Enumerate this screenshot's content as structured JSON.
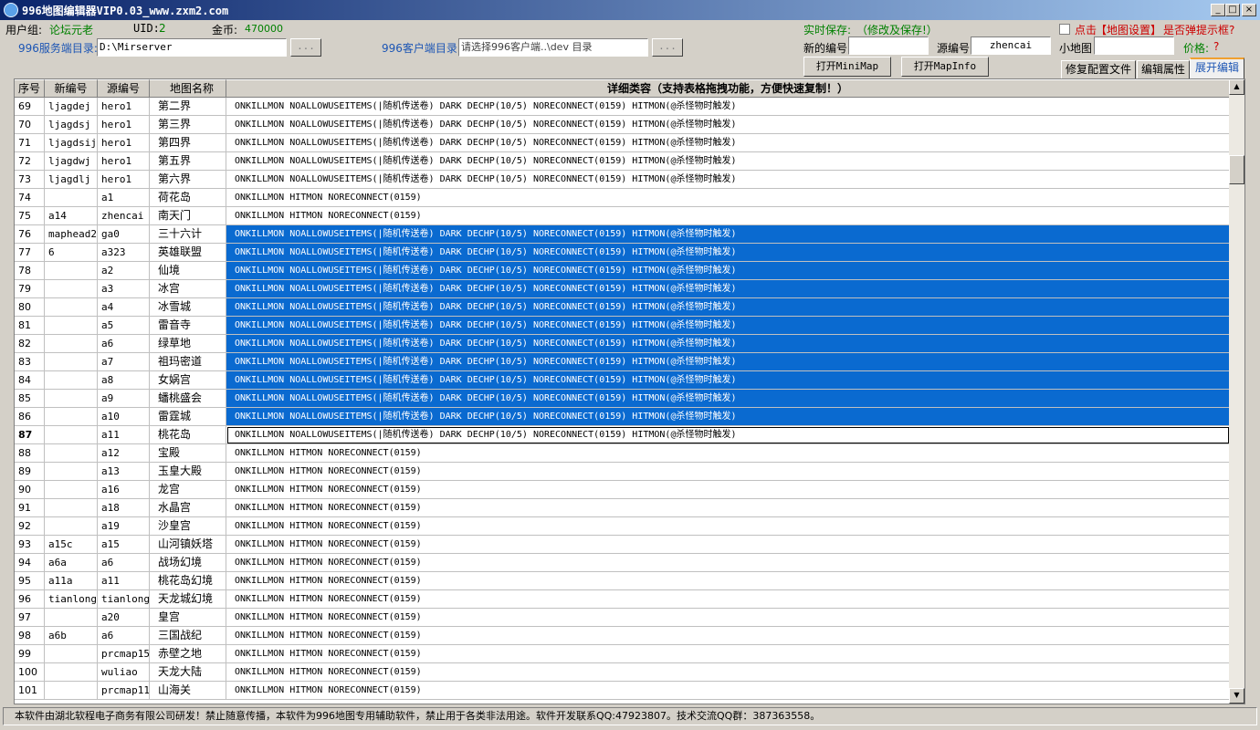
{
  "window": {
    "title": "996地图编辑器VIP0.03_www.zxm2.com",
    "minimize": "_",
    "maximize": "□",
    "close": "×"
  },
  "colors": {
    "accent": "#1c55b4",
    "green": "#008000",
    "selection": "#0a6ad0",
    "red": "#cc0000"
  },
  "info": {
    "usergroup_label": "用户组:",
    "usergroup_value": "论坛元老",
    "uid_label": "UID:",
    "uid_value": "2",
    "coins_label": "金币:",
    "coins_value": "470000"
  },
  "save": {
    "label": "实时保存:",
    "note": "（修改及保存!）"
  },
  "popup": {
    "prefix": "点击",
    "link": "【地图设置】",
    "suffix": "是否弹提示框?"
  },
  "paths": {
    "server_label": "996服务端目录:",
    "server_value": "D:\\Mirserver",
    "client_label": "996客户端目录:",
    "client_value": "请选择996客户端..\\dev 目录",
    "browse": "..."
  },
  "fields": {
    "new_id_label": "新的编号",
    "new_id_value": "",
    "source_id_label": "源编号",
    "source_id_value": "zhencai",
    "minimap_label": "小地图",
    "minimap_value": "",
    "price_label": "价格:",
    "price_value": "?"
  },
  "buttons": {
    "open_minimap": "打开MiniMap",
    "open_mapinfo": "打开MapInfo"
  },
  "tabs": [
    {
      "label": "修复配置文件"
    },
    {
      "label": "编辑属性"
    },
    {
      "label": "展开编辑"
    }
  ],
  "grid": {
    "headers": [
      "序号",
      "新编号",
      "源编号",
      "地图名称",
      "详细类容（支持表格拖拽功能，方便快速复制！）"
    ],
    "rows": [
      [
        "69",
        "ljagdej",
        "hero1",
        "第二界",
        "ONKILLMON NOALLOWUSEITEMS(|随机传送卷) DARK DECHP(10/5) NORECONNECT(0159) HITMON(@杀怪物时触发)"
      ],
      [
        "70",
        "ljagdsj",
        "hero1",
        "第三界",
        "ONKILLMON NOALLOWUSEITEMS(|随机传送卷) DARK DECHP(10/5) NORECONNECT(0159) HITMON(@杀怪物时触发)"
      ],
      [
        "71",
        "ljagdsij",
        "hero1",
        "第四界",
        "ONKILLMON NOALLOWUSEITEMS(|随机传送卷) DARK DECHP(10/5) NORECONNECT(0159) HITMON(@杀怪物时触发)"
      ],
      [
        "72",
        "ljagdwj",
        "hero1",
        "第五界",
        "ONKILLMON NOALLOWUSEITEMS(|随机传送卷) DARK DECHP(10/5) NORECONNECT(0159) HITMON(@杀怪物时触发)"
      ],
      [
        "73",
        "ljagdlj",
        "hero1",
        "第六界",
        "ONKILLMON NOALLOWUSEITEMS(|随机传送卷) DARK DECHP(10/5) NORECONNECT(0159) HITMON(@杀怪物时触发)"
      ],
      [
        "74",
        "",
        "a1",
        "荷花岛",
        "ONKILLMON HITMON NORECONNECT(0159)"
      ],
      [
        "75",
        "a14",
        "zhencai",
        "南天门",
        "ONKILLMON HITMON NORECONNECT(0159)"
      ],
      [
        "76",
        "maphead28",
        "ga0",
        "三十六计",
        "ONKILLMON NOALLOWUSEITEMS(|随机传送卷) DARK DECHP(10/5) NORECONNECT(0159) HITMON(@杀怪物时触发)"
      ],
      [
        "77",
        "6",
        "a323",
        "英雄联盟",
        "ONKILLMON NOALLOWUSEITEMS(|随机传送卷) DARK DECHP(10/5) NORECONNECT(0159) HITMON(@杀怪物时触发)"
      ],
      [
        "78",
        "",
        "a2",
        "仙境",
        "ONKILLMON NOALLOWUSEITEMS(|随机传送卷) DARK DECHP(10/5) NORECONNECT(0159) HITMON(@杀怪物时触发)"
      ],
      [
        "79",
        "",
        "a3",
        "冰宫",
        "ONKILLMON NOALLOWUSEITEMS(|随机传送卷) DARK DECHP(10/5) NORECONNECT(0159) HITMON(@杀怪物时触发)"
      ],
      [
        "80",
        "",
        "a4",
        "冰雪城",
        "ONKILLMON NOALLOWUSEITEMS(|随机传送卷) DARK DECHP(10/5) NORECONNECT(0159) HITMON(@杀怪物时触发)"
      ],
      [
        "81",
        "",
        "a5",
        "雷音寺",
        "ONKILLMON NOALLOWUSEITEMS(|随机传送卷) DARK DECHP(10/5) NORECONNECT(0159) HITMON(@杀怪物时触发)"
      ],
      [
        "82",
        "",
        "a6",
        "绿草地",
        "ONKILLMON NOALLOWUSEITEMS(|随机传送卷) DARK DECHP(10/5) NORECONNECT(0159) HITMON(@杀怪物时触发)"
      ],
      [
        "83",
        "",
        "a7",
        "祖玛密道",
        "ONKILLMON NOALLOWUSEITEMS(|随机传送卷) DARK DECHP(10/5) NORECONNECT(0159) HITMON(@杀怪物时触发)"
      ],
      [
        "84",
        "",
        "a8",
        "女娲宫",
        "ONKILLMON NOALLOWUSEITEMS(|随机传送卷) DARK DECHP(10/5) NORECONNECT(0159) HITMON(@杀怪物时触发)"
      ],
      [
        "85",
        "",
        "a9",
        "蟠桃盛会",
        "ONKILLMON NOALLOWUSEITEMS(|随机传送卷) DARK DECHP(10/5) NORECONNECT(0159) HITMON(@杀怪物时触发)"
      ],
      [
        "86",
        "",
        "a10",
        "雷霆城",
        "ONKILLMON NOALLOWUSEITEMS(|随机传送卷) DARK DECHP(10/5) NORECONNECT(0159) HITMON(@杀怪物时触发)"
      ],
      [
        "87",
        "",
        "a11",
        "桃花岛",
        "ONKILLMON NOALLOWUSEITEMS(|随机传送卷) DARK DECHP(10/5) NORECONNECT(0159) HITMON(@杀怪物时触发)"
      ],
      [
        "88",
        "",
        "a12",
        "宝殿",
        "ONKILLMON HITMON NORECONNECT(0159)"
      ],
      [
        "89",
        "",
        "a13",
        "玉皇大殿",
        "ONKILLMON HITMON NORECONNECT(0159)"
      ],
      [
        "90",
        "",
        "a16",
        "龙宫",
        "ONKILLMON HITMON NORECONNECT(0159)"
      ],
      [
        "91",
        "",
        "a18",
        "水晶宫",
        "ONKILLMON HITMON NORECONNECT(0159)"
      ],
      [
        "92",
        "",
        "a19",
        "沙皇宫",
        "ONKILLMON HITMON NORECONNECT(0159)"
      ],
      [
        "93",
        "a15c",
        "a15",
        "山河镇妖塔",
        "ONKILLMON HITMON NORECONNECT(0159)"
      ],
      [
        "94",
        "a6a",
        "a6",
        "战场幻境",
        "ONKILLMON HITMON NORECONNECT(0159)"
      ],
      [
        "95",
        "a11a",
        "a11",
        "桃花岛幻境",
        "ONKILLMON HITMON NORECONNECT(0159)"
      ],
      [
        "96",
        "tianlongs",
        "tianlong",
        "天龙城幻境",
        "ONKILLMON HITMON NORECONNECT(0159)"
      ],
      [
        "97",
        "",
        "a20",
        "皇宫",
        "ONKILLMON HITMON NORECONNECT(0159)"
      ],
      [
        "98",
        "a6b",
        "a6",
        "三国战纪",
        "ONKILLMON HITMON NORECONNECT(0159)"
      ],
      [
        "99",
        "",
        "prcmap15",
        "赤壁之地",
        "ONKILLMON HITMON NORECONNECT(0159)"
      ],
      [
        "100",
        "",
        "wuliao",
        "天龙大陆",
        "ONKILLMON HITMON NORECONNECT(0159)"
      ],
      [
        "101",
        "",
        "prcmap11",
        "山海关",
        "ONKILLMON HITMON NORECONNECT(0159)"
      ]
    ],
    "selected_rows": [
      "76",
      "77",
      "78",
      "79",
      "80",
      "81",
      "82",
      "83",
      "84",
      "85",
      "86"
    ],
    "current_row": "87"
  },
  "scroll": {
    "up": "▲",
    "down": "▼"
  },
  "status": "本软件由湖北软程电子商务有限公司研发！禁止随意传播，本软件为996地图专用辅助软件，禁止用于各类非法用途。软件开发联系QQ:47923807。技术交流QQ群：387363558。"
}
